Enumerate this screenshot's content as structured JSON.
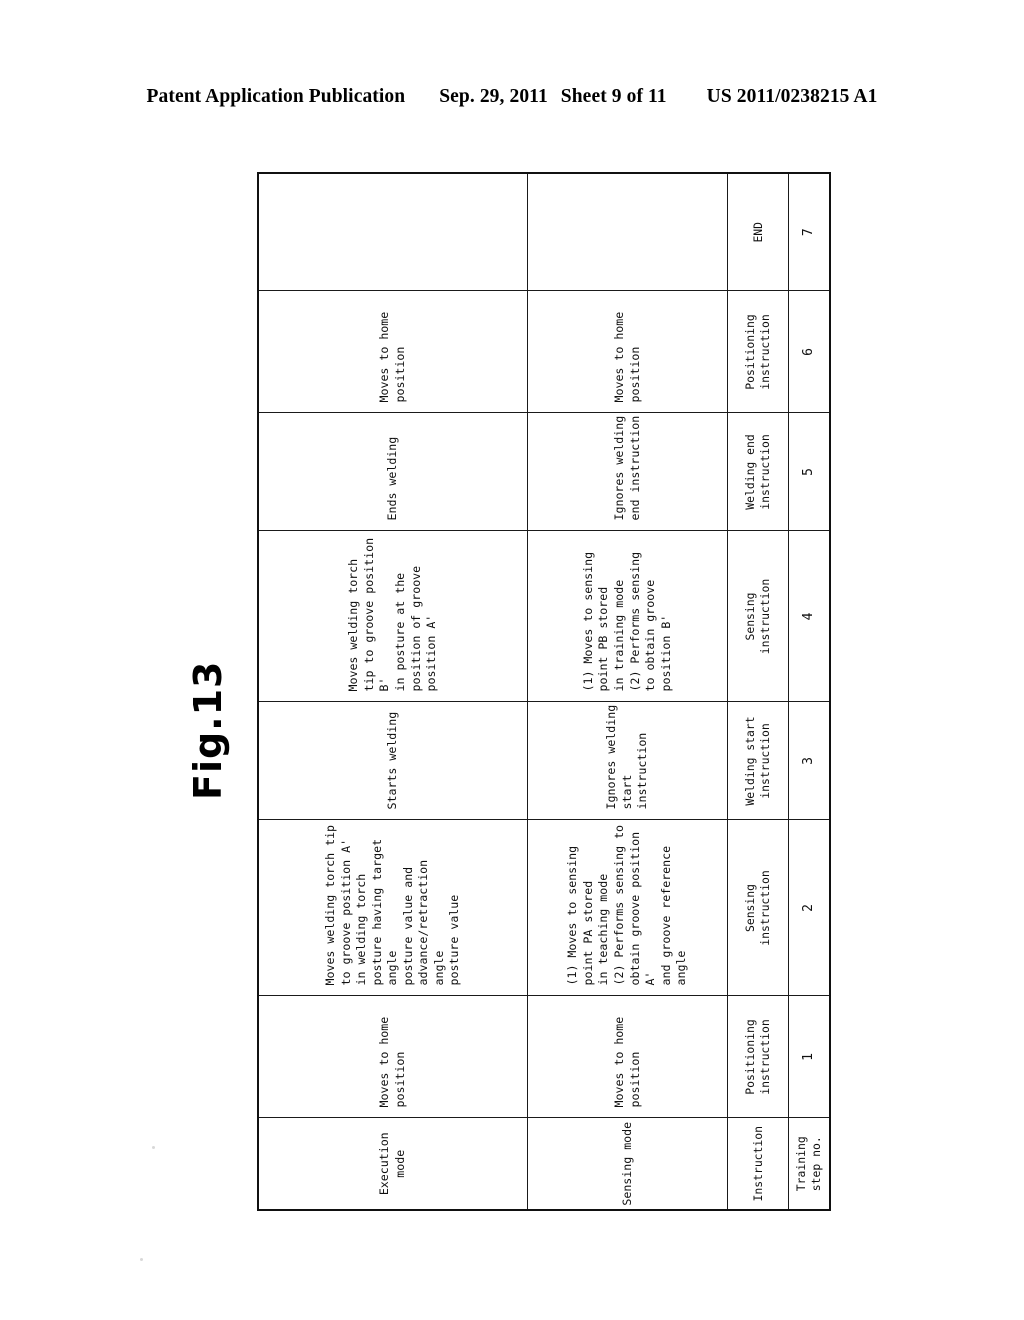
{
  "header": {
    "publication": "Patent Application Publication",
    "date": "Sep. 29, 2011",
    "sheet": "Sheet 9 of 11",
    "number": "US 2011/0238215 A1"
  },
  "figure": {
    "label": "Fig.13"
  },
  "table": {
    "columns": [
      "Training\nstep no.",
      "Instruction",
      "Sensing mode",
      "Execution mode"
    ],
    "rows": [
      {
        "step": "1",
        "instruction": "Positioning\ninstruction",
        "sensing_mode": "Moves to home position",
        "execution_mode": "Moves to home position"
      },
      {
        "step": "2",
        "instruction": "Sensing\ninstruction",
        "sensing_mode": "(1) Moves to sensing point PA stored\n     in teaching mode\n(2) Performs sensing to obtain groove position A'\n     and groove reference angle",
        "execution_mode": "Moves welding torch tip to groove position A'\nin welding torch posture having target angle\nposture value and advance/retraction angle\nposture value"
      },
      {
        "step": "3",
        "instruction": "Welding start\ninstruction",
        "sensing_mode": "Ignores welding start instruction",
        "execution_mode": "Starts welding"
      },
      {
        "step": "4",
        "instruction": "Sensing\ninstruction",
        "sensing_mode": "(1) Moves to sensing point PB stored\n     in training mode\n(2) Performs sensing to obtain groove position B'",
        "execution_mode": "Moves welding torch tip to groove position B'\nin posture at the position of groove position A'"
      },
      {
        "step": "5",
        "instruction": "Welding end\ninstruction",
        "sensing_mode": "Ignores welding end instruction",
        "execution_mode": "Ends welding"
      },
      {
        "step": "6",
        "instruction": "Positioning\ninstruction",
        "sensing_mode": "Moves to home position",
        "execution_mode": "Moves to home position"
      },
      {
        "step": "7",
        "instruction": "END",
        "sensing_mode": "",
        "execution_mode": ""
      }
    ]
  }
}
